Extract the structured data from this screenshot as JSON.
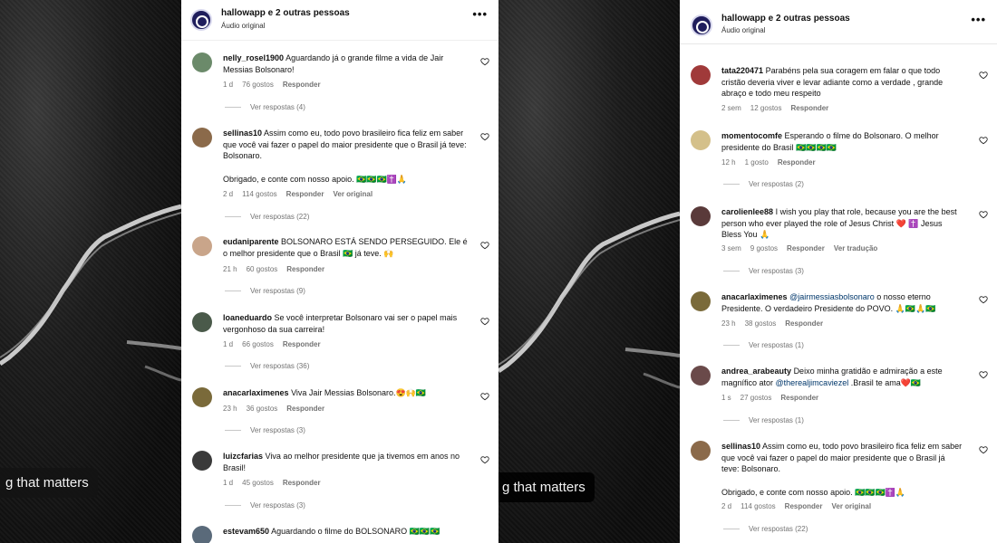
{
  "left_caption": "g that matters",
  "right_caption": "g that matters",
  "left_panel": {
    "header": {
      "title": "hallowapp e 2 outras pessoas",
      "subtitle": "Áudio original"
    },
    "comments": [
      {
        "user": "nelly_rosel1900",
        "text": "Aguardando já o grande filme a vida de Jair Messias Bolsonaro!",
        "time": "1 d",
        "likes": "76 gostos",
        "reply": "Responder",
        "see_original": "",
        "replies": "Ver respostas (4)",
        "avatar_color": "#6b8a6a"
      },
      {
        "user": "sellinas10",
        "text": "Assim como eu, todo povo brasileiro fica feliz em saber que você vai fazer o papel do maior presidente que o Brasil já teve: Bolsonaro.",
        "text2": "Obrigado, e conte com nosso apoio. 🇧🇷🇧🇷🇧🇷✝️🙏",
        "time": "2 d",
        "likes": "114 gostos",
        "reply": "Responder",
        "see_original": "Ver original",
        "replies": "Ver respostas (22)",
        "avatar_color": "#8b6a4a"
      },
      {
        "user": "eudaniparente",
        "text": "BOLSONARO ESTÁ SENDO PERSEGUIDO. Ele é o melhor presidente que o Brasil 🇧🇷 já teve. 🙌",
        "time": "21 h",
        "likes": "60 gostos",
        "reply": "Responder",
        "see_original": "",
        "replies": "Ver respostas (9)",
        "avatar_color": "#c9a58a"
      },
      {
        "user": "loaneduardo",
        "text": "Se você interpretar Bolsonaro vai ser o papel mais vergonhoso da sua carreira!",
        "time": "1 d",
        "likes": "66 gostos",
        "reply": "Responder",
        "see_original": "",
        "replies": "Ver respostas (36)",
        "avatar_color": "#4a5a4a"
      },
      {
        "user": "anacarlaximenes",
        "text": "Viva Jair Messias Bolsonaro.😍🙌🇧🇷",
        "time": "23 h",
        "likes": "36 gostos",
        "reply": "Responder",
        "see_original": "",
        "replies": "Ver respostas (3)",
        "avatar_color": "#7a6a3a"
      },
      {
        "user": "luizcfarias",
        "text": "Viva ao melhor presidente que ja tivemos em anos no Brasil!",
        "time": "1 d",
        "likes": "45 gostos",
        "reply": "Responder",
        "see_original": "",
        "replies": "Ver respostas (3)",
        "avatar_color": "#3a3a3a"
      },
      {
        "user": "estevam650",
        "text": "Aguardando o filme do BOLSONARO 🇧🇷🇧🇷🇧🇷",
        "avatar_color": "#5a6a7a"
      }
    ]
  },
  "right_panel": {
    "header": {
      "title": "hallowapp e 2 outras pessoas",
      "subtitle": "Áudio original"
    },
    "comments": [
      {
        "user": "tata220471",
        "text": "Parabéns pela sua coragem em falar o que todo cristão deveria viver e levar adiante como a verdade , grande abraço e todo meu respeito",
        "time": "2 sem",
        "likes": "12 gostos",
        "reply": "Responder",
        "see_original": "",
        "replies": "",
        "avatar_color": "#a03a3a"
      },
      {
        "user": "momentocomfe",
        "text": "Esperando o filme do Bolsonaro. O melhor presidente do Brasil 🇧🇷🇧🇷🇧🇷🇧🇷",
        "time": "12 h",
        "likes": "1 gosto",
        "reply": "Responder",
        "see_original": "",
        "replies": "Ver respostas (2)",
        "avatar_color": "#d4c08a"
      },
      {
        "user": "carolienlee88",
        "text": "I wish you play that role, because you are the best person who ever played the role of Jesus Christ ❤️ ✝️ Jesus Bless You 🙏",
        "time": "3 sem",
        "likes": "9 gostos",
        "reply": "Responder",
        "see_original": "Ver tradução",
        "replies": "Ver respostas (3)",
        "avatar_color": "#5a3a3a"
      },
      {
        "user": "anacarlaximenes",
        "text_mention": "@jairmessiasbolsonaro",
        "text": " o nosso eterno Presidente. O verdadeiro Presidente do POVO. 🙏🇧🇷🙏🇧🇷",
        "time": "23 h",
        "likes": "38 gostos",
        "reply": "Responder",
        "see_original": "",
        "replies": "Ver respostas (1)",
        "avatar_color": "#7a6a3a"
      },
      {
        "user": "andrea_arabeauty",
        "text": "Deixo minha gratidão e admiração a este magnífico ator ",
        "text_mention": "@therealjimcaviezel",
        "text_after": " .Brasil te ama❤️🇧🇷",
        "time": "1 s",
        "likes": "27 gostos",
        "reply": "Responder",
        "see_original": "",
        "replies": "Ver respostas (1)",
        "avatar_color": "#6a4a4a"
      },
      {
        "user": "sellinas10",
        "text": "Assim como eu, todo povo brasileiro fica feliz em saber que você vai fazer o papel do maior presidente que o Brasil já teve: Bolsonaro.",
        "text2": "Obrigado, e conte com nosso apoio. 🇧🇷🇧🇷🇧🇷✝️🙏",
        "time": "2 d",
        "likes": "114 gostos",
        "reply": "Responder",
        "see_original": "Ver original",
        "replies": "Ver respostas (22)",
        "avatar_color": "#8b6a4a"
      }
    ]
  }
}
